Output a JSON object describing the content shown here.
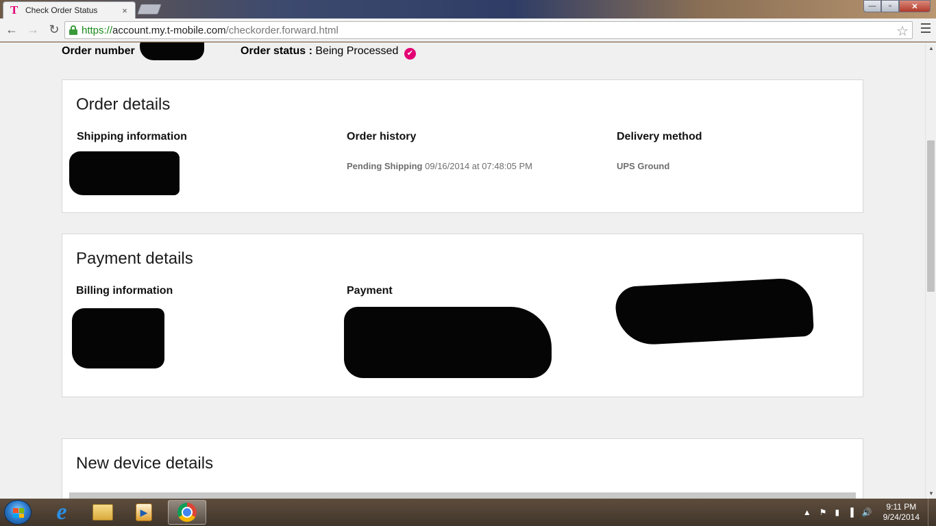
{
  "browser": {
    "tab_title": "Check Order Status",
    "tab_close": "×",
    "url_scheme": "https://",
    "url_host": "account.my.t-mobile.com",
    "url_path": "/checkorder.forward.html",
    "window_controls": {
      "minimize": "—",
      "maximize": "▫",
      "close": "✕"
    }
  },
  "page": {
    "order_number_label": "Order number",
    "order_status_label": "Order status :",
    "order_status_value": "Being Processed",
    "order_details": {
      "title": "Order details",
      "shipping_heading": "Shipping information",
      "history_heading": "Order history",
      "history_status": "Pending Shipping",
      "history_timestamp": "09/16/2014 at 07:48:05 PM",
      "delivery_heading": "Delivery method",
      "delivery_value": "UPS Ground"
    },
    "payment_details": {
      "title": "Payment details",
      "billing_heading": "Billing information",
      "payment_heading": "Payment"
    },
    "new_device": {
      "title": "New device details"
    }
  },
  "taskbar": {
    "clock_time": "9:11 PM",
    "clock_date": "9/24/2014"
  },
  "colors": {
    "brand_magenta": "#e20074",
    "secure_green": "#1a8a1a"
  }
}
